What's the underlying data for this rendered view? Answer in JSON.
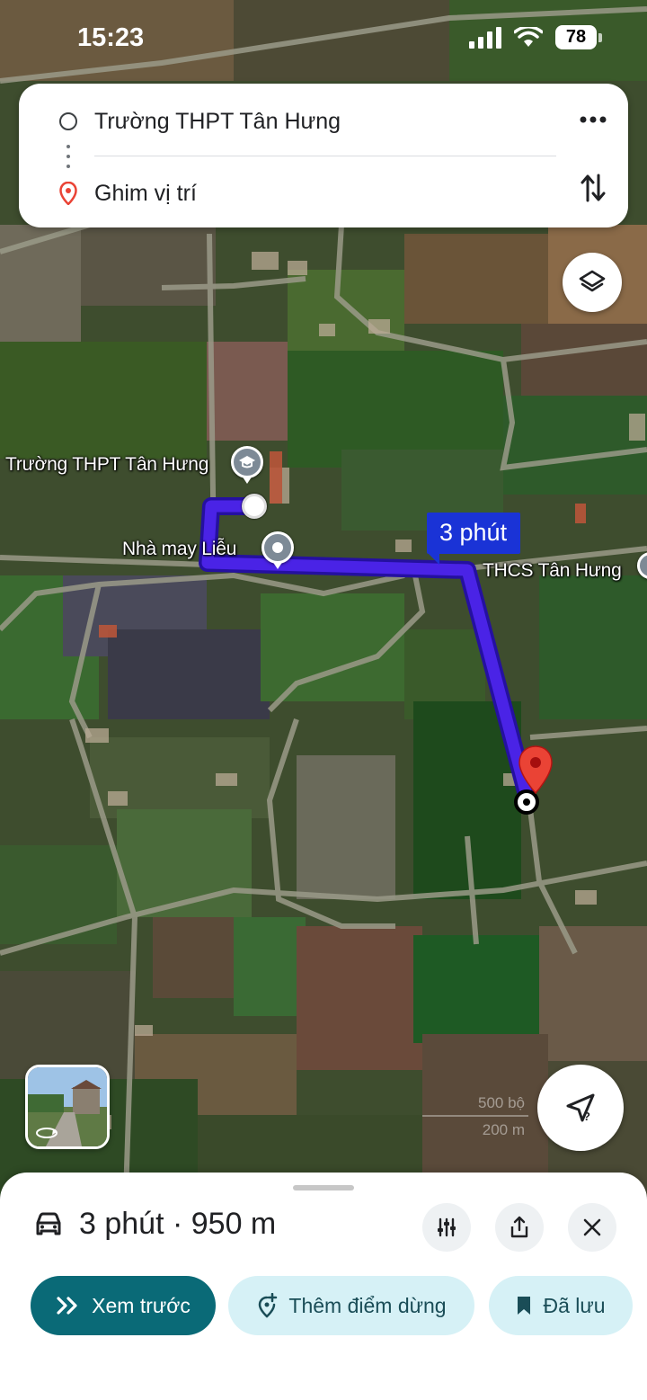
{
  "status_bar": {
    "time": "15:23",
    "battery": "78",
    "icons": [
      "cellular-signal-icon",
      "wifi-icon",
      "battery-icon"
    ]
  },
  "route_card": {
    "origin": "Trường THPT Tân Hưng",
    "destination": "Ghim vị trí",
    "icons": [
      "origin-circle-icon",
      "destination-pin-icon",
      "more-vert-icon",
      "swap-icon"
    ]
  },
  "map": {
    "labels": {
      "school": "Trường THPT Tân Hưng",
      "tailor": "Nhà may Liễu",
      "secondary_school": "THCS Tân Hưng"
    },
    "route_time": "3 phút",
    "scale": {
      "feet": "500 bộ",
      "meters": "200 m"
    },
    "colors": {
      "route": "#4a23e6",
      "destination_pin": "#ea4335",
      "bubble": "#1a33d6"
    }
  },
  "bottom_sheet": {
    "summary": "3 phút · 950 m",
    "buttons": {
      "preview": "Xem trước",
      "add_stop": "Thêm điểm dừng",
      "saved": "Đã lưu"
    },
    "colors": {
      "primary": "#0a6a77",
      "secondary_bg": "#d6f1f6"
    }
  }
}
